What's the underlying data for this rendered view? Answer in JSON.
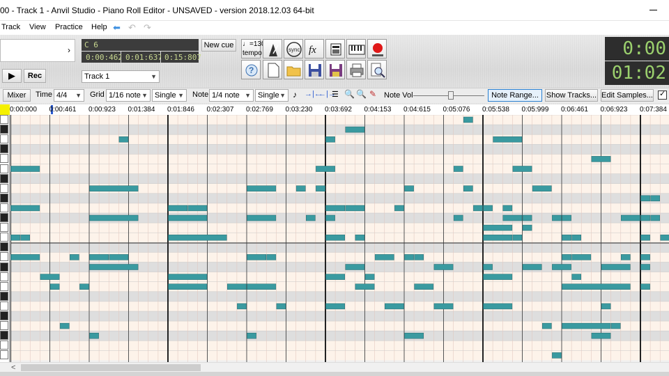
{
  "window": {
    "title": "00 - Track 1 - Anvil Studio - Piano Roll Editor - UNSAVED - version 2018.12.03 64-bit"
  },
  "menu": {
    "items": [
      "Track",
      "View",
      "Practice",
      "Help"
    ]
  },
  "transport": {
    "note_name": "C 6",
    "time_a": "0:00:462",
    "time_b": "0:01:637",
    "time_c": "0:15:807",
    "new_cue_label": "New cue",
    "tempo_value": "=130",
    "tempo_label": "tempo",
    "rec_label": "Rec",
    "track_select": "Track 1",
    "big_time_top": "0:00",
    "big_time_bottom": "01:02"
  },
  "options": {
    "mixer": "Mixer",
    "time_label": "Time",
    "time_value": "4/4",
    "grid_label": "Grid",
    "grid_value": "1/16 note",
    "grid_mode": "Single",
    "note_label": "Note",
    "note_value": "1/4 note",
    "note_mode": "Single",
    "note_vol_label": "Note Vol",
    "note_range": "Note Range...",
    "show_tracks": "Show Tracks...",
    "edit_samples": "Edit Samples..."
  },
  "ruler": [
    "0:00:000",
    "0:00:461",
    "0:00:923",
    "0:01:384",
    "0:01:846",
    "0:02:307",
    "0:02:769",
    "0:03:230",
    "0:03:692",
    "0:04:153",
    "0:04:615",
    "0:05:076",
    "0:05:538",
    "0:05:999",
    "0:06:461",
    "0:06:923",
    "0:07:384"
  ],
  "colors": {
    "note": "#3a9aa0",
    "lcd_text": "#9bd06d",
    "grid_white": "#fdf3ea",
    "grid_gray": "#dedede",
    "playhead": "#2a5ad0"
  },
  "icons": [
    "tempo-icon",
    "metronome-icon",
    "sync-icon",
    "fx-icon",
    "instrument-icon",
    "keyboard-icon",
    "record-icon",
    "help-icon",
    "new-file-icon",
    "open-folder-icon",
    "save-icon",
    "save-as-icon",
    "print-icon",
    "print-preview-icon"
  ]
}
